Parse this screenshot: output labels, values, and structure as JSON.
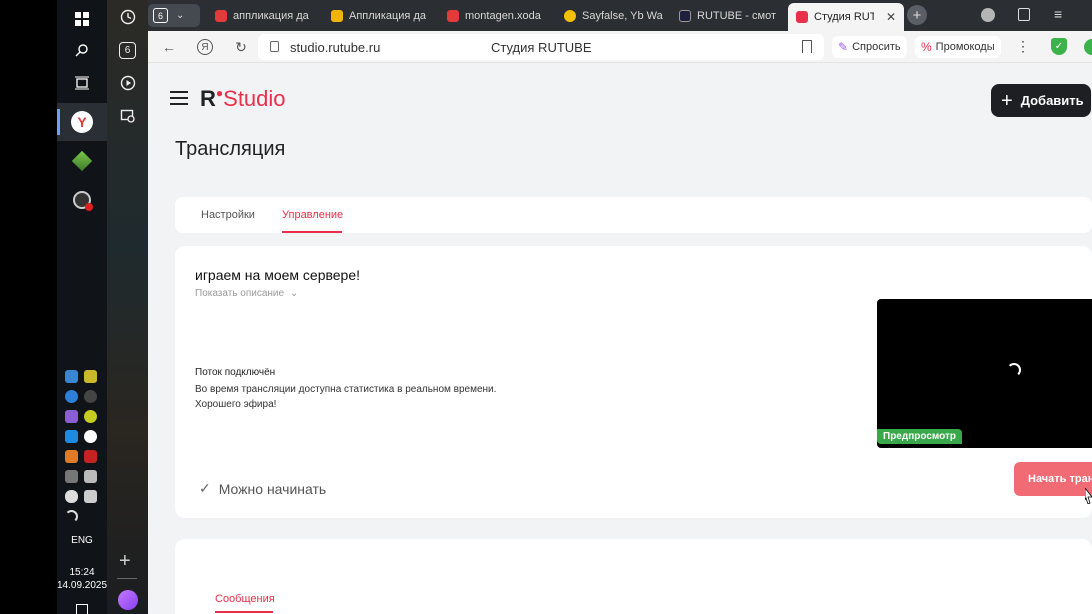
{
  "taskbar": {
    "lang": "ENG",
    "time": "15:24",
    "date": "14.09.2025"
  },
  "tabs": [
    {
      "label": "аппликация да",
      "color": "#e23b3b"
    },
    {
      "label": "Аппликация да",
      "color": "#f2b600"
    },
    {
      "label": "montagen.xoda",
      "color": "#e23b3b"
    },
    {
      "label": "Sayfalse, Yb Wa",
      "color": "#f2c200"
    },
    {
      "label": "RUTUBE - смот",
      "color": "#1e1f3a"
    },
    {
      "label": "Студия RUTUBE",
      "color": "#e8304a"
    }
  ],
  "tab_group_count": "6",
  "address_bar": {
    "url": "studio.rutube.ru",
    "title": "Студия RUTUBE",
    "ask_label": "Спросить",
    "promo_label": "Промокоды"
  },
  "header": {
    "logo_r": "R",
    "logo_studio": "Studio",
    "add_label": "Добавить"
  },
  "page": {
    "title": "Трансляция",
    "tabs": [
      "Настройки",
      "Управление"
    ],
    "active_tab": "Управление"
  },
  "stream": {
    "title": "играем на моем сервере!",
    "show_description": "Показать описание",
    "status_title": "Поток подключён",
    "status_lines": [
      "Во время трансляции доступна статистика в реальном времени.",
      "Хорошего эфира!"
    ],
    "preview_badge": "Предпросмотр",
    "ready_label": "Можно начинать",
    "start_label": "Начать трансляцию"
  },
  "messages": {
    "tab_label": "Сообщения"
  },
  "colors": {
    "accent": "#e8304a",
    "start_button": "#f06b73",
    "preview_badge": "#38a84a"
  }
}
